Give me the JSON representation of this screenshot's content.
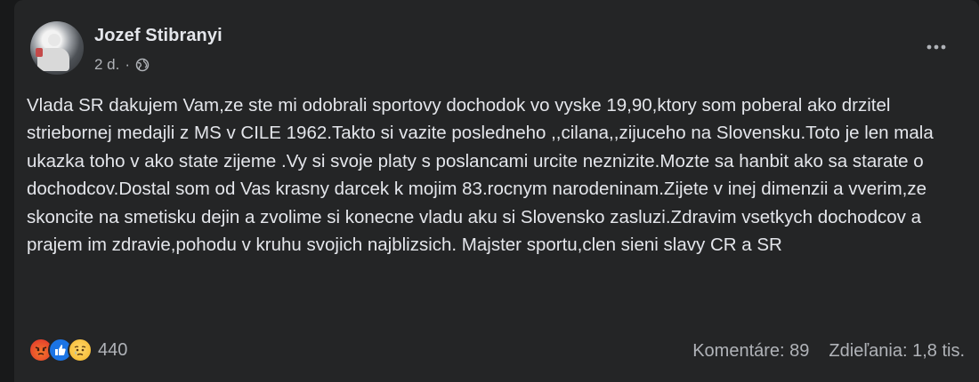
{
  "post": {
    "author": "Jozef Stibranyi",
    "time": "2 d.",
    "separator": "·",
    "privacy_icon": "globe-icon",
    "more_icon": "more-options-icon",
    "text": "Vlada SR dakujem Vam,ze ste mi odobrali sportovy dochodok vo vyske 19,90,ktory som poberal ako drzitel striebornej medajli z MS v CILE 1962.Takto si vazite posledneho ,,cilana,,zijuceho na Slovensku.Toto je len mala ukazka toho v ako state zijeme .Vy si svoje platy s poslancami urcite neznizite.Mozte sa hanbit ako sa starate o dochodcov.Dostal som od Vas krasny darcek k mojim 83.rocnym narodeninam.Zijete v inej dimenzii a vverim,ze skoncite na smetisku dejin a zvolime si konecne vladu aku si Slovensko zasluzi.Zdravim vsetkych dochodcov a prajem im zdravie,pohodu v kruhu svojich najblizsich. Majster sportu,clen sieni slavy CR a SR"
  },
  "reactions": {
    "icons": [
      "angry-emoji",
      "like-icon",
      "sad-emoji"
    ],
    "count": "440"
  },
  "stats": {
    "comments": "Komentáre: 89",
    "shares": "Zdieľania: 1,8 tis."
  },
  "colors": {
    "background": "#242526",
    "text_primary": "#e4e6eb",
    "text_secondary": "#b0b3b8",
    "like_blue": "#1b74e4"
  }
}
